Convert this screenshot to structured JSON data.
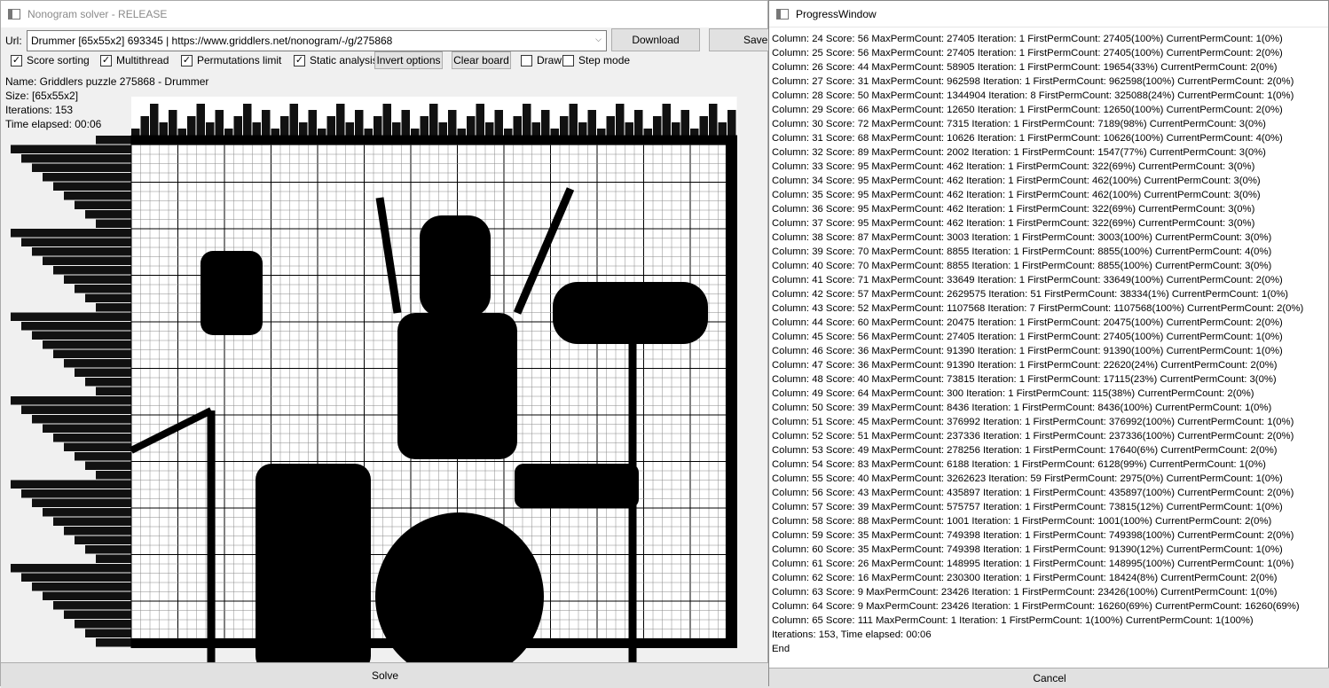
{
  "main": {
    "title": "Nonogram solver - RELEASE",
    "url_label": "Url:",
    "url_value": "Drummer [65x55x2] 693345 | https://www.griddlers.net/nonogram/-/g/275868",
    "download_label": "Download",
    "save_label": "Save",
    "options": [
      {
        "label": "Score sorting",
        "checked": true
      },
      {
        "label": "Multithread",
        "checked": true
      },
      {
        "label": "Permutations limit",
        "checked": true
      },
      {
        "label": "Static analysis",
        "checked": true
      }
    ],
    "invert_label": "Invert options",
    "clear_label": "Clear board",
    "draw_label": "Draw",
    "draw_checked": false,
    "step_label": "Step mode",
    "step_checked": false,
    "info": {
      "name": "Name: Griddlers puzzle 275868 - Drummer",
      "size": "Size: [65x55x2]",
      "iterations": "Iterations: 153",
      "time": "Time elapsed: 00:06"
    },
    "solve_label": "Solve"
  },
  "progress": {
    "title": "ProgressWindow",
    "lines": [
      "Column: 24 Score: 56 MaxPermCount: 27405 Iteration: 1 FirstPermCount: 27405(100%) CurrentPermCount: 1(0%)",
      "Column: 25 Score: 56 MaxPermCount: 27405 Iteration: 1 FirstPermCount: 27405(100%) CurrentPermCount: 2(0%)",
      "Column: 26 Score: 44 MaxPermCount: 58905 Iteration: 1 FirstPermCount: 19654(33%) CurrentPermCount: 2(0%)",
      "Column: 27 Score: 31 MaxPermCount: 962598 Iteration: 1 FirstPermCount: 962598(100%) CurrentPermCount: 2(0%)",
      "Column: 28 Score: 50 MaxPermCount: 1344904 Iteration: 8 FirstPermCount: 325088(24%) CurrentPermCount: 1(0%)",
      "Column: 29 Score: 66 MaxPermCount: 12650 Iteration: 1 FirstPermCount: 12650(100%) CurrentPermCount: 2(0%)",
      "Column: 30 Score: 72 MaxPermCount: 7315 Iteration: 1 FirstPermCount: 7189(98%) CurrentPermCount: 3(0%)",
      "Column: 31 Score: 68 MaxPermCount: 10626 Iteration: 1 FirstPermCount: 10626(100%) CurrentPermCount: 4(0%)",
      "Column: 32 Score: 89 MaxPermCount: 2002 Iteration: 1 FirstPermCount: 1547(77%) CurrentPermCount: 3(0%)",
      "Column: 33 Score: 95 MaxPermCount: 462 Iteration: 1 FirstPermCount: 322(69%) CurrentPermCount: 3(0%)",
      "Column: 34 Score: 95 MaxPermCount: 462 Iteration: 1 FirstPermCount: 462(100%) CurrentPermCount: 3(0%)",
      "Column: 35 Score: 95 MaxPermCount: 462 Iteration: 1 FirstPermCount: 462(100%) CurrentPermCount: 3(0%)",
      "Column: 36 Score: 95 MaxPermCount: 462 Iteration: 1 FirstPermCount: 322(69%) CurrentPermCount: 3(0%)",
      "Column: 37 Score: 95 MaxPermCount: 462 Iteration: 1 FirstPermCount: 322(69%) CurrentPermCount: 3(0%)",
      "Column: 38 Score: 87 MaxPermCount: 3003 Iteration: 1 FirstPermCount: 3003(100%) CurrentPermCount: 3(0%)",
      "Column: 39 Score: 70 MaxPermCount: 8855 Iteration: 1 FirstPermCount: 8855(100%) CurrentPermCount: 4(0%)",
      "Column: 40 Score: 70 MaxPermCount: 8855 Iteration: 1 FirstPermCount: 8855(100%) CurrentPermCount: 3(0%)",
      "Column: 41 Score: 71 MaxPermCount: 33649 Iteration: 1 FirstPermCount: 33649(100%) CurrentPermCount: 2(0%)",
      "Column: 42 Score: 57 MaxPermCount: 2629575 Iteration: 51 FirstPermCount: 38334(1%) CurrentPermCount: 1(0%)",
      "Column: 43 Score: 52 MaxPermCount: 1107568 Iteration: 7 FirstPermCount: 1107568(100%) CurrentPermCount: 2(0%)",
      "Column: 44 Score: 60 MaxPermCount: 20475 Iteration: 1 FirstPermCount: 20475(100%) CurrentPermCount: 2(0%)",
      "Column: 45 Score: 56 MaxPermCount: 27405 Iteration: 1 FirstPermCount: 27405(100%) CurrentPermCount: 1(0%)",
      "Column: 46 Score: 36 MaxPermCount: 91390 Iteration: 1 FirstPermCount: 91390(100%) CurrentPermCount: 1(0%)",
      "Column: 47 Score: 36 MaxPermCount: 91390 Iteration: 1 FirstPermCount: 22620(24%) CurrentPermCount: 2(0%)",
      "Column: 48 Score: 40 MaxPermCount: 73815 Iteration: 1 FirstPermCount: 17115(23%) CurrentPermCount: 3(0%)",
      "Column: 49 Score: 64 MaxPermCount: 300 Iteration: 1 FirstPermCount: 115(38%) CurrentPermCount: 2(0%)",
      "Column: 50 Score: 39 MaxPermCount: 8436 Iteration: 1 FirstPermCount: 8436(100%) CurrentPermCount: 1(0%)",
      "Column: 51 Score: 45 MaxPermCount: 376992 Iteration: 1 FirstPermCount: 376992(100%) CurrentPermCount: 1(0%)",
      "Column: 52 Score: 51 MaxPermCount: 237336 Iteration: 1 FirstPermCount: 237336(100%) CurrentPermCount: 2(0%)",
      "Column: 53 Score: 49 MaxPermCount: 278256 Iteration: 1 FirstPermCount: 17640(6%) CurrentPermCount: 2(0%)",
      "Column: 54 Score: 83 MaxPermCount: 6188 Iteration: 1 FirstPermCount: 6128(99%) CurrentPermCount: 1(0%)",
      "Column: 55 Score: 40 MaxPermCount: 3262623 Iteration: 59 FirstPermCount: 2975(0%) CurrentPermCount: 1(0%)",
      "Column: 56 Score: 43 MaxPermCount: 435897 Iteration: 1 FirstPermCount: 435897(100%) CurrentPermCount: 2(0%)",
      "Column: 57 Score: 39 MaxPermCount: 575757 Iteration: 1 FirstPermCount: 73815(12%) CurrentPermCount: 1(0%)",
      "Column: 58 Score: 88 MaxPermCount: 1001 Iteration: 1 FirstPermCount: 1001(100%) CurrentPermCount: 2(0%)",
      "Column: 59 Score: 35 MaxPermCount: 749398 Iteration: 1 FirstPermCount: 749398(100%) CurrentPermCount: 2(0%)",
      "Column: 60 Score: 35 MaxPermCount: 749398 Iteration: 1 FirstPermCount: 91390(12%) CurrentPermCount: 1(0%)",
      "Column: 61 Score: 26 MaxPermCount: 148995 Iteration: 1 FirstPermCount: 148995(100%) CurrentPermCount: 1(0%)",
      "Column: 62 Score: 16 MaxPermCount: 230300 Iteration: 1 FirstPermCount: 18424(8%) CurrentPermCount: 2(0%)",
      "Column: 63 Score: 9 MaxPermCount: 23426 Iteration: 1 FirstPermCount: 23426(100%) CurrentPermCount: 1(0%)",
      "Column: 64 Score: 9 MaxPermCount: 23426 Iteration: 1 FirstPermCount: 16260(69%) CurrentPermCount: 16260(69%)",
      "Column: 65 Score: 111 MaxPermCount: 1 Iteration: 1 FirstPermCount: 1(100%) CurrentPermCount: 1(100%)",
      "Iterations: 153, Time elapsed: 00:06",
      "End"
    ],
    "cancel_label": "Cancel"
  }
}
